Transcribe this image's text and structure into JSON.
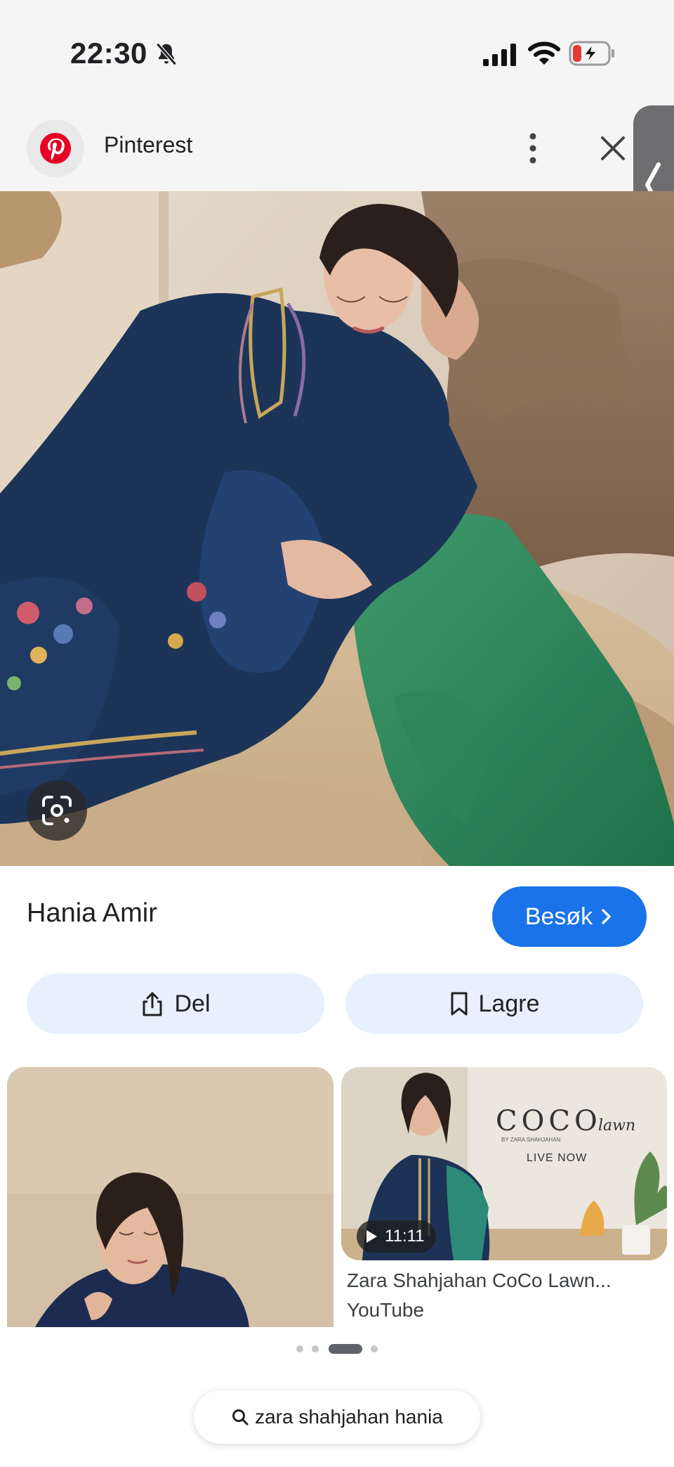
{
  "status_bar": {
    "time": "22:30",
    "icons": [
      "bell-muted-icon",
      "cellular-signal-icon",
      "wifi-icon",
      "battery-charging-icon"
    ]
  },
  "header": {
    "favicon": "pinterest-logo-icon",
    "site_name": "Pinterest",
    "more_icon": "more-vertical-icon",
    "close_icon": "close-icon"
  },
  "hero": {
    "lens_icon": "google-lens-icon"
  },
  "result": {
    "title": "Hania Amir",
    "visit_label": "Besøk",
    "visit_icon": "chevron-right-icon"
  },
  "actions": {
    "share_label": "Del",
    "share_icon": "share-icon",
    "save_label": "Lagre",
    "save_icon": "bookmark-icon"
  },
  "related": {
    "right_card": {
      "duration": "11:11",
      "title": "Zara Shahjahan CoCo Lawn...",
      "source": "YouTube",
      "thumb_brand": "COCO",
      "thumb_brand_script": "lawn",
      "thumb_byline": "BY ZARA SHAHJAHAN",
      "thumb_live": "LIVE NOW"
    }
  },
  "pager": {
    "count": 4,
    "active_index": 2
  },
  "bottom_search": {
    "query": "zara shahjahan hania",
    "icon": "search-icon"
  },
  "colors": {
    "accent": "#1a73e8",
    "pill_bg": "#e8effd",
    "pinterest_red": "#e60023"
  }
}
